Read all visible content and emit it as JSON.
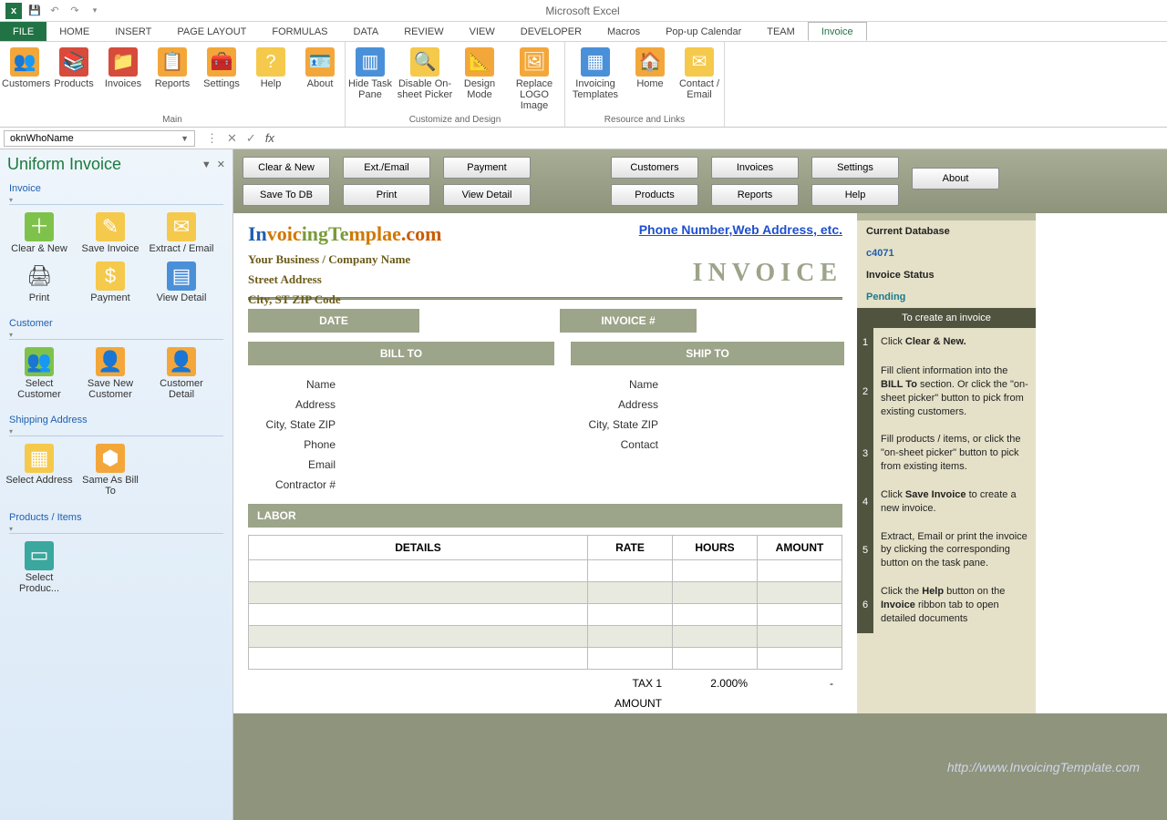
{
  "titlebar": {
    "app_title": "Microsoft Excel"
  },
  "ribbon": {
    "tabs": [
      "FILE",
      "HOME",
      "INSERT",
      "PAGE LAYOUT",
      "FORMULAS",
      "DATA",
      "REVIEW",
      "VIEW",
      "DEVELOPER",
      "Macros",
      "Pop-up Calendar",
      "TEAM",
      "Invoice"
    ],
    "active_tab": "Invoice",
    "groups": {
      "main": {
        "label": "Main",
        "items": [
          "Customers",
          "Products",
          "Invoices",
          "Reports",
          "Settings",
          "Help",
          "About"
        ]
      },
      "customize": {
        "label": "Customize and Design",
        "items": [
          "Hide Task Pane",
          "Disable On-sheet Picker",
          "Design Mode",
          "Replace LOGO Image"
        ]
      },
      "resource": {
        "label": "Resource and Links",
        "items": [
          "Invoicing Templates",
          "Home",
          "Contact / Email"
        ]
      }
    }
  },
  "formula_bar": {
    "namebox": "oknWhoName",
    "fx_label": "fx",
    "value": ""
  },
  "taskpane": {
    "title": "Uniform Invoice",
    "sections": {
      "invoice": {
        "title": "Invoice",
        "items": [
          "Clear & New",
          "Save Invoice",
          "Extract / Email",
          "Print",
          "Payment",
          "View Detail"
        ]
      },
      "customer": {
        "title": "Customer",
        "items": [
          "Select Customer",
          "Save New Customer",
          "Customer Detail"
        ]
      },
      "shipping": {
        "title": "Shipping Address",
        "items": [
          "Select Address",
          "Same As Bill To"
        ]
      },
      "products": {
        "title": "Products / Items",
        "items": [
          "Select Produc..."
        ]
      }
    }
  },
  "toolbar": {
    "col1": [
      "Clear & New",
      "Save To DB"
    ],
    "col2": [
      "Ext./Email",
      "Print"
    ],
    "col3": [
      "Payment",
      "View Detail"
    ],
    "col4": [
      "Customers",
      "Products"
    ],
    "col5": [
      "Invoices",
      "Reports"
    ],
    "col6": [
      "Settings",
      "Help"
    ],
    "about": "About"
  },
  "invoice": {
    "brand": "InvoicingTemplae.com",
    "contact_link": "Phone Number,Web Address, etc.",
    "business_name": "Your Business / Company Name",
    "street": "Street Address",
    "city_line": "City, ST  ZIP Code",
    "title": "INVOICE",
    "date_label": "DATE",
    "invoice_no_label": "INVOICE #",
    "bill_to_label": "BILL TO",
    "ship_to_label": "SHIP TO",
    "bill_fields": [
      "Name",
      "Address",
      "City, State ZIP",
      "Phone",
      "Email",
      "Contractor #"
    ],
    "ship_fields": [
      "Name",
      "Address",
      "City, State ZIP",
      "Contact"
    ],
    "labor_label": "LABOR",
    "table_headers": [
      "DETAILS",
      "RATE",
      "HOURS",
      "AMOUNT"
    ],
    "tax1_label": "TAX 1",
    "tax1_rate": "2.000%",
    "tax1_amount": "-",
    "amount_label": "AMOUNT"
  },
  "info_panel": {
    "db_label": "Current Database",
    "db_value": "c4071",
    "status_label": "Invoice Status",
    "status_value": "Pending",
    "header": "To create an invoice",
    "steps": [
      "Click <b>Clear & New.</b>",
      "Fill client information into the <b>BILL To</b> section. Or click the \"on-sheet picker\" button to pick from existing customers.",
      "Fill products / items, or click the \"on-sheet picker\" button to pick from existing items.",
      "Click <b>Save Invoice</b> to create a new invoice.",
      "Extract, Email or print the invoice by clicking the corresponding button on the task pane.",
      "Click the <b>Help</b> button on the <b>Invoice</b> ribbon tab to open detailed documents"
    ]
  },
  "watermark": "http://www.InvoicingTemplate.com"
}
